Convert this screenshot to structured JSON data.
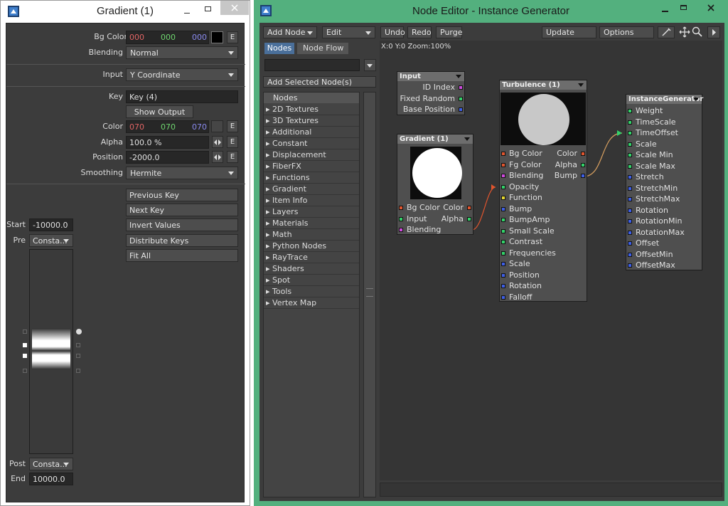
{
  "left": {
    "title": "Gradient (1)",
    "bg_color": {
      "label": "Bg Color",
      "r": "000",
      "g": "000",
      "b": "000",
      "e": "E"
    },
    "blending": {
      "label": "Blending",
      "value": "Normal"
    },
    "input": {
      "label": "Input",
      "value": "Y Coordinate"
    },
    "key": {
      "label": "Key",
      "value": "Key (4)"
    },
    "show_output": "Show Output",
    "color": {
      "label": "Color",
      "r": "070",
      "g": "070",
      "b": "070",
      "e": "E"
    },
    "alpha": {
      "label": "Alpha",
      "value": "100.0 %",
      "e": "E"
    },
    "position": {
      "label": "Position",
      "value": "-2000.0",
      "e": "E"
    },
    "smoothing": {
      "label": "Smoothing",
      "value": "Hermite"
    },
    "buttons": [
      "Previous Key",
      "Next Key",
      "Invert Values",
      "Distribute Keys",
      "Fit All"
    ],
    "start": {
      "label": "Start",
      "value": "-10000.0"
    },
    "pre": {
      "label": "Pre",
      "value": "Consta..."
    },
    "post": {
      "label": "Post",
      "value": "Consta..."
    },
    "end": {
      "label": "End",
      "value": "10000.0"
    },
    "colors": {
      "red": "#e06464",
      "green": "#6ed46e",
      "blue": "#8a8aee"
    }
  },
  "right": {
    "title": "Node Editor - Instance Generator",
    "toolbar": {
      "add_node": "Add Node",
      "edit": "Edit",
      "undo": "Undo",
      "redo": "Redo",
      "purge": "Purge",
      "update": "Update",
      "options": "Options"
    },
    "tabs": [
      "Nodes",
      "Node Flow"
    ],
    "add_selected": "Add Selected Node(s)",
    "status": "X:0 Y:0 Zoom:100%",
    "node_list_header": "Nodes",
    "categories": [
      "2D Textures",
      "3D Textures",
      "Additional",
      "Constant",
      "Displacement",
      "FiberFX",
      "Functions",
      "Gradient",
      "Item Info",
      "Layers",
      "Materials",
      "Math",
      "Python Nodes",
      "RayTrace",
      "Shaders",
      "Spot",
      "Tools",
      "Vertex Map"
    ],
    "nodes": {
      "input": {
        "title": "Input",
        "outputs": [
          {
            "name": "ID Index",
            "color": "#d04adf"
          },
          {
            "name": "Fixed Random",
            "color": "#34d26a"
          },
          {
            "name": "Base Position",
            "color": "#3e5fe6"
          }
        ]
      },
      "gradient": {
        "title": "Gradient (1)",
        "inputs": [
          {
            "name": "Bg Color",
            "color": "#e0552e"
          },
          {
            "name": "Input",
            "color": "#34d26a"
          },
          {
            "name": "Blending",
            "color": "#d04adf"
          }
        ],
        "outputs": [
          {
            "name": "Color",
            "color": "#e0552e"
          },
          {
            "name": "Alpha",
            "color": "#34d26a"
          }
        ]
      },
      "turbulence": {
        "title": "Turbulence (1)",
        "inputs": [
          {
            "name": "Bg Color",
            "color": "#e0552e"
          },
          {
            "name": "Fg Color",
            "color": "#e0552e"
          },
          {
            "name": "Blending",
            "color": "#d04adf"
          },
          {
            "name": "Opacity",
            "color": "#34d26a"
          },
          {
            "name": "Function",
            "color": "#e6d830"
          },
          {
            "name": "Bump",
            "color": "#3e5fe6"
          },
          {
            "name": "BumpAmp",
            "color": "#34d26a"
          },
          {
            "name": "Small Scale",
            "color": "#34d26a"
          },
          {
            "name": "Contrast",
            "color": "#34d26a"
          },
          {
            "name": "Frequencies",
            "color": "#34d26a"
          },
          {
            "name": "Scale",
            "color": "#3e5fe6"
          },
          {
            "name": "Position",
            "color": "#3e5fe6"
          },
          {
            "name": "Rotation",
            "color": "#3e5fe6"
          },
          {
            "name": "Falloff",
            "color": "#3e5fe6"
          }
        ],
        "outputs": [
          {
            "name": "Color",
            "color": "#e0552e"
          },
          {
            "name": "Alpha",
            "color": "#34d26a"
          },
          {
            "name": "Bump",
            "color": "#3e5fe6"
          }
        ]
      },
      "instance": {
        "title": "InstanceGenerator",
        "inputs": [
          {
            "name": "Weight",
            "color": "#34d26a"
          },
          {
            "name": "TimeScale",
            "color": "#34d26a"
          },
          {
            "name": "TimeOffset",
            "color": "#34d26a"
          },
          {
            "name": "Scale",
            "color": "#34d26a"
          },
          {
            "name": "Scale Min",
            "color": "#34d26a"
          },
          {
            "name": "Scale Max",
            "color": "#34d26a"
          },
          {
            "name": "Stretch",
            "color": "#3e5fe6"
          },
          {
            "name": "StretchMin",
            "color": "#3e5fe6"
          },
          {
            "name": "StretchMax",
            "color": "#3e5fe6"
          },
          {
            "name": "Rotation",
            "color": "#3e5fe6"
          },
          {
            "name": "RotationMin",
            "color": "#3e5fe6"
          },
          {
            "name": "RotationMax",
            "color": "#3e5fe6"
          },
          {
            "name": "Offset",
            "color": "#3e5fe6"
          },
          {
            "name": "OffsetMin",
            "color": "#3e5fe6"
          },
          {
            "name": "OffsetMax",
            "color": "#3e5fe6"
          }
        ]
      }
    },
    "frame_color": "#53b07e"
  }
}
